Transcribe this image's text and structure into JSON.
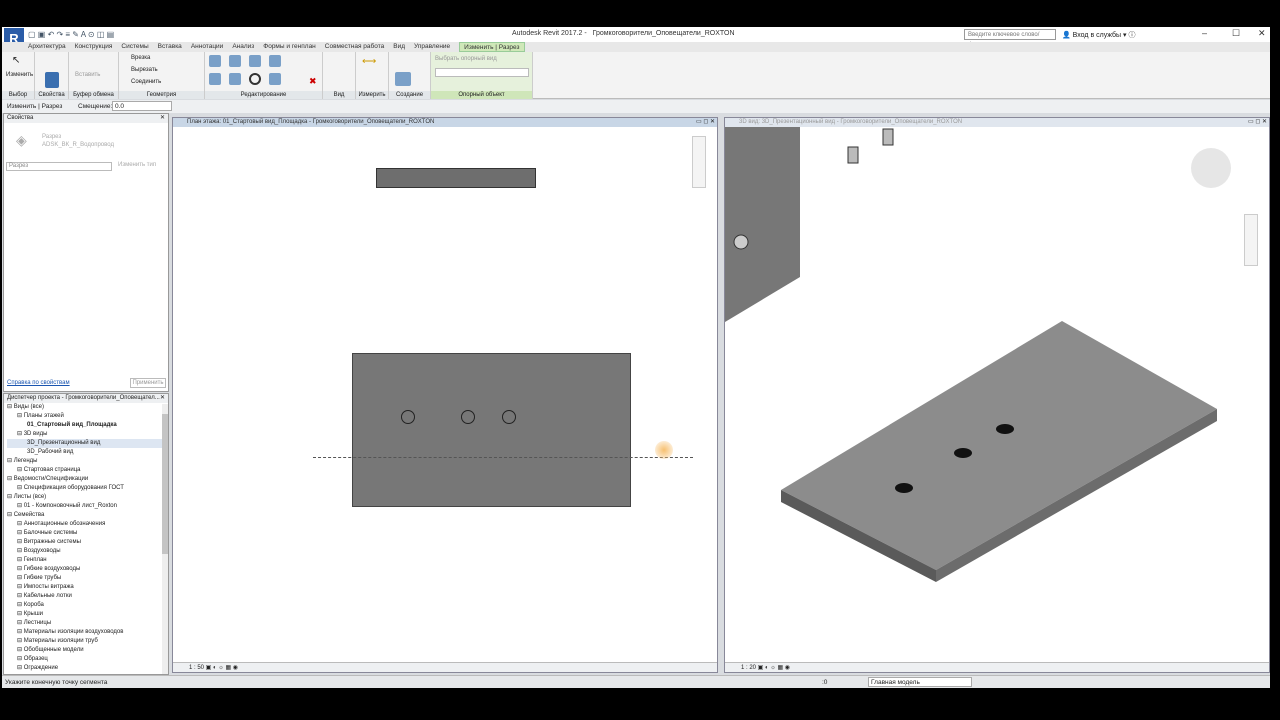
{
  "app": {
    "title": "Autodesk Revit 2017.2 -",
    "file": "Громкоговорители_Оповещатели_ROXTON",
    "logo": "R",
    "search_placeholder": "Введите ключевое слово/фразу",
    "login": "Вход в службы"
  },
  "tabs": [
    "Архитектура",
    "Конструкция",
    "Системы",
    "Вставка",
    "Аннотации",
    "Анализ",
    "Формы и генплан",
    "Совместная работа",
    "Вид",
    "Управление",
    "Изменить | Разрез"
  ],
  "ribbon": {
    "modify": "Изменить",
    "paste": "Вставить",
    "cut_join": [
      "Врезка",
      "Вырезать",
      "Соединить"
    ],
    "pick_ref": "Выбрать опорный вид",
    "panels": [
      "Выбор",
      "Свойства",
      "Буфер обмена",
      "Геометрия",
      "Редактирование",
      "Вид",
      "Измерить",
      "Создание",
      "Опорный объект"
    ]
  },
  "options": {
    "context": "Изменить | Разрез",
    "offset_label": "Смещение:",
    "offset_value": "0.0"
  },
  "properties": {
    "title": "Свойства",
    "type_name": "Разрез",
    "type_sub": "ADSK_ВК_R_Водопровод",
    "filter": "Разрез",
    "edit_type": "Изменить тип",
    "help": "Справка по свойствам",
    "apply": "Применить"
  },
  "browser": {
    "title": "Диспетчер проекта - Громкоговорители_Оповещател...",
    "items": [
      {
        "t": "Виды (все)",
        "l": 0
      },
      {
        "t": "Планы этажей",
        "l": 1
      },
      {
        "t": "01_Стартовый вид_Площадка",
        "l": 2,
        "bold": true
      },
      {
        "t": "3D виды",
        "l": 1
      },
      {
        "t": "3D_Презентационный вид",
        "l": 2,
        "sel": true
      },
      {
        "t": "3D_Рабочий вид",
        "l": 2
      },
      {
        "t": "Легенды",
        "l": 0
      },
      {
        "t": "Стартовая страница",
        "l": 1
      },
      {
        "t": "Ведомости/Спецификации",
        "l": 0
      },
      {
        "t": "Спецификация оборудования ГОСТ",
        "l": 1
      },
      {
        "t": "Листы (все)",
        "l": 0
      },
      {
        "t": "01 - Компоновочный лист_Roxton",
        "l": 1
      },
      {
        "t": "Семейства",
        "l": 0
      },
      {
        "t": "Аннотационные обозначения",
        "l": 1
      },
      {
        "t": "Балочные системы",
        "l": 1
      },
      {
        "t": "Витражные системы",
        "l": 1
      },
      {
        "t": "Воздуховоды",
        "l": 1
      },
      {
        "t": "Генплан",
        "l": 1
      },
      {
        "t": "Гибкие воздуховоды",
        "l": 1
      },
      {
        "t": "Гибкие трубы",
        "l": 1
      },
      {
        "t": "Импосты витража",
        "l": 1
      },
      {
        "t": "Кабельные лотки",
        "l": 1
      },
      {
        "t": "Короба",
        "l": 1
      },
      {
        "t": "Крыши",
        "l": 1
      },
      {
        "t": "Лестницы",
        "l": 1
      },
      {
        "t": "Материалы изоляции воздуховодов",
        "l": 1
      },
      {
        "t": "Материалы изоляции труб",
        "l": 1
      },
      {
        "t": "Обобщенные модели",
        "l": 1
      },
      {
        "t": "Образец",
        "l": 1
      },
      {
        "t": "Ограждение",
        "l": 1
      }
    ]
  },
  "plan_view": {
    "title": "План этажа: 01_Стартовый вид_Площадка - Громкоговорители_Оповещатели_ROXTON",
    "scale": "1 : 50"
  },
  "view3d": {
    "title": "3D вид: 3D_Презентационный вид - Громкоговорители_Оповещатели_ROXTON",
    "scale": "1 : 20"
  },
  "status": {
    "text": "Укажите конечную точку сегмента",
    "zero": ":0",
    "model": "Главная модель"
  },
  "colors": {
    "accent": "#cfe8b8",
    "slab": "#7a7a7a"
  }
}
